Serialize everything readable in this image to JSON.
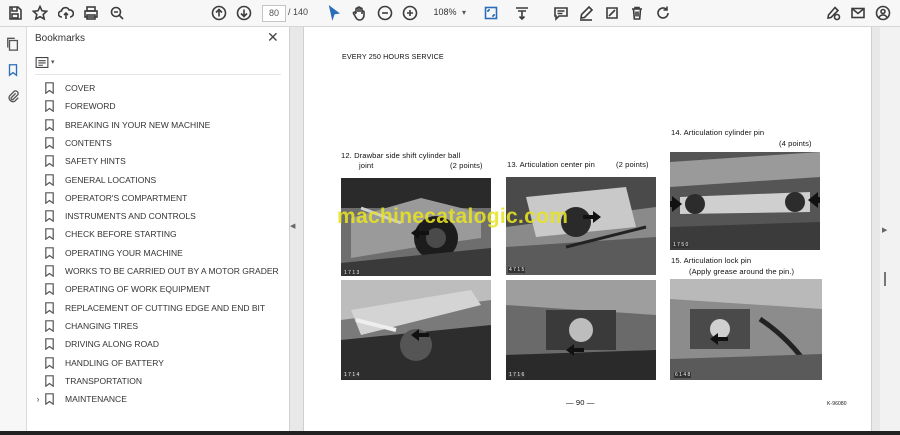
{
  "toolbar": {
    "page_current": "80",
    "page_total": "/ 140",
    "zoom": "108%",
    "zoom_caret": "▾"
  },
  "panel": {
    "title": "Bookmarks",
    "close": "✕",
    "options_caret": "▾",
    "items": [
      {
        "label": "COVER",
        "expand": ""
      },
      {
        "label": "FOREWORD",
        "expand": ""
      },
      {
        "label": "BREAKING IN YOUR NEW MACHINE",
        "expand": ""
      },
      {
        "label": "CONTENTS",
        "expand": ""
      },
      {
        "label": "SAFETY HINTS",
        "expand": ""
      },
      {
        "label": "GENERAL LOCATIONS",
        "expand": ""
      },
      {
        "label": "OPERATOR'S COMPARTMENT",
        "expand": ""
      },
      {
        "label": "INSTRUMENTS AND CONTROLS",
        "expand": ""
      },
      {
        "label": "CHECK BEFORE STARTING",
        "expand": ""
      },
      {
        "label": "OPERATING YOUR MACHINE",
        "expand": ""
      },
      {
        "label": "WORKS TO BE CARRIED OUT BY A MOTOR GRADER",
        "expand": ""
      },
      {
        "label": "OPERATING OF WORK EQUIPMENT",
        "expand": ""
      },
      {
        "label": "REPLACEMENT OF CUTTING EDGE AND END BIT",
        "expand": ""
      },
      {
        "label": "CHANGING TIRES",
        "expand": ""
      },
      {
        "label": "DRIVING ALONG ROAD",
        "expand": ""
      },
      {
        "label": "HANDLING OF BATTERY",
        "expand": ""
      },
      {
        "label": "TRANSPORTATION",
        "expand": ""
      },
      {
        "label": "MAINTENANCE",
        "expand": "›"
      }
    ]
  },
  "document": {
    "header": "EVERY 250 HOURS SERVICE",
    "item12_title": "12.  Drawbar side shift cylinder ball",
    "item12_cont": "joint",
    "item12_points": "(2 points)",
    "item13_title": "13.  Articulation center pin",
    "item13_points": "(2 points)",
    "item14_title": "14.  Articulation cylinder pin",
    "item14_points": "(4 points)",
    "item15_title": "15.  Articulation lock pin",
    "item15_note": "(Apply grease around the pin.)",
    "page_number": "— 90 —",
    "doc_code": "K-96080",
    "watermark": "machinecatalogic.com",
    "fig_labels": [
      "1 7 1 3",
      "1 7 1 4",
      "4 7 1 5",
      "1 7 1 6",
      "1 7 5 0",
      "6 1 4 8"
    ]
  },
  "navigation": {
    "collapse_left": "◀",
    "expand_right": "▶"
  },
  "colors": {
    "watermark": "#e7e322",
    "toolbar_bg": "#f7f7f7",
    "doc_bg": "#e8e8e8",
    "accent": "#2a6ebb"
  }
}
